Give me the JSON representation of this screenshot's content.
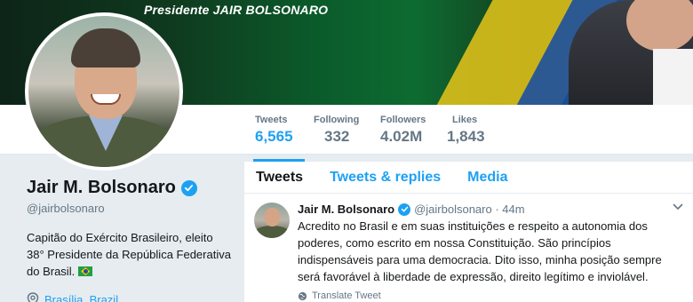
{
  "banner": {
    "title": "Presidente JAIR BOLSONARO"
  },
  "nav": {
    "stats": [
      {
        "label": "Tweets",
        "value": "6,565",
        "active": true
      },
      {
        "label": "Following",
        "value": "332",
        "active": false
      },
      {
        "label": "Followers",
        "value": "4.02M",
        "active": false
      },
      {
        "label": "Likes",
        "value": "1,843",
        "active": false
      }
    ]
  },
  "profile": {
    "name": "Jair M. Bolsonaro",
    "handle": "@jairbolsonaro",
    "bio": "Capitão do Exército Brasileiro, eleito 38° Presidente da República Federativa do Brasil.",
    "location": "Brasília, Brazil"
  },
  "timeline": {
    "tabs": [
      {
        "label": "Tweets",
        "active": true
      },
      {
        "label": "Tweets & replies",
        "active": false
      },
      {
        "label": "Media",
        "active": false
      }
    ],
    "tweet": {
      "name": "Jair M. Bolsonaro",
      "meta": "@jairbolsonaro · 44m",
      "text": "Acredito no Brasil e em suas instituições e respeito a autonomia dos poderes, como escrito em nossa Constituição. São princípios indispensáveis para uma democracia. Dito isso, minha posição sempre será favorável à liberdade de expressão, direito legítimo e inviolável.",
      "translate_label": "Translate Tweet"
    }
  },
  "colors": {
    "accent": "#1da1f2",
    "text": "#14171a",
    "muted": "#657786",
    "background": "#e6ecf0"
  },
  "icons": [
    "verified-badge-icon",
    "location-pin-icon",
    "chevron-down-icon",
    "globe-icon",
    "brazil-flag-icon"
  ]
}
